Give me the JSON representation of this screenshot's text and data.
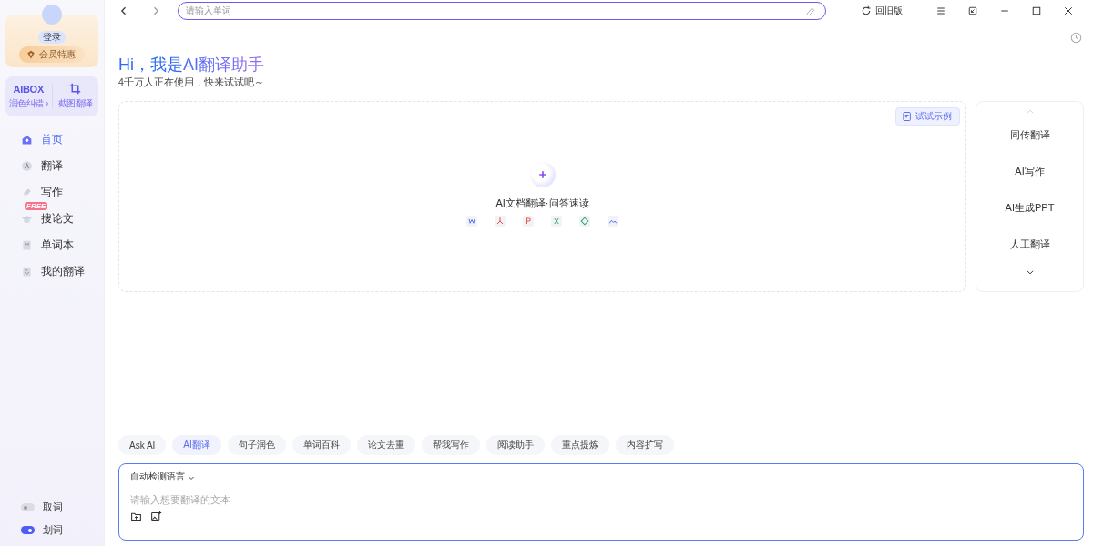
{
  "sidebar": {
    "login": "登录",
    "vip": "会员特惠",
    "tools": [
      {
        "kind": "logo",
        "logo": "AIBOX",
        "label": "润色纠错 ›"
      },
      {
        "kind": "crop",
        "label": "截图翻译"
      }
    ],
    "nav": [
      {
        "kind": "home",
        "label": "首页",
        "selected": true
      },
      {
        "kind": "translate",
        "label": "翻译",
        "selected": false
      },
      {
        "kind": "pen",
        "label": "写作",
        "selected": false
      },
      {
        "kind": "cap",
        "label": "搜论文",
        "selected": false,
        "badge": "FREE"
      },
      {
        "kind": "book",
        "label": "单词本",
        "selected": false
      },
      {
        "kind": "note",
        "label": "我的翻译",
        "selected": false
      }
    ],
    "toggles": [
      {
        "label": "取词",
        "on": false
      },
      {
        "label": "划词",
        "on": true
      }
    ]
  },
  "top_bar": {
    "search": {
      "placeholder": "请输入单词"
    },
    "old_version": "回旧版"
  },
  "hero": {
    "title_plain": "Hi，我是",
    "title_gradient": "AI翻译助手",
    "subtitle": "4千万人正在使用，快来试试吧～"
  },
  "upload": {
    "example_button": "试试示例",
    "label": "AI文档翻译·问答速读"
  },
  "feature_list": [
    "同传翻译",
    "AI写作",
    "AI生成PPT",
    "人工翻译"
  ],
  "chips": [
    {
      "label": "Ask AI",
      "selected": false
    },
    {
      "label": "AI翻译",
      "selected": true
    },
    {
      "label": "句子润色",
      "selected": false
    },
    {
      "label": "单词百科",
      "selected": false
    },
    {
      "label": "论文去重",
      "selected": false
    },
    {
      "label": "帮我写作",
      "selected": false
    },
    {
      "label": "阅读助手",
      "selected": false
    },
    {
      "label": "重点提炼",
      "selected": false
    },
    {
      "label": "内容扩写",
      "selected": false
    }
  ],
  "input": {
    "language": "自动检测语言",
    "placeholder": "请输入想要翻译的文本"
  }
}
